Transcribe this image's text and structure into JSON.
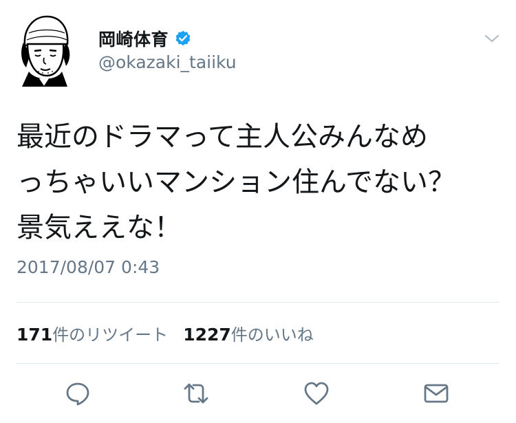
{
  "user": {
    "display_name": "岡崎体育",
    "handle": "@okazaki_taiiku"
  },
  "tweet": {
    "text": "最近のドラマって主人公みんなめ\nっちゃいいマンション住んでない？\n景気ええな！",
    "timestamp": "2017/08/07 0:43"
  },
  "stats": {
    "retweets": "171",
    "retweets_label": "件のリツイート",
    "likes": "1227",
    "likes_label": "件のいいね"
  },
  "icons": {
    "avatar": "avatar-illustration",
    "verified": "verified-badge-icon",
    "caret": "chevron-down-icon",
    "reply": "reply-icon",
    "retweet": "retweet-icon",
    "like": "heart-icon",
    "dm": "envelope-icon"
  },
  "colors": {
    "text": "#14171a",
    "secondary": "#657786",
    "verified": "#1da1f2",
    "divider": "#e1e8ed"
  }
}
